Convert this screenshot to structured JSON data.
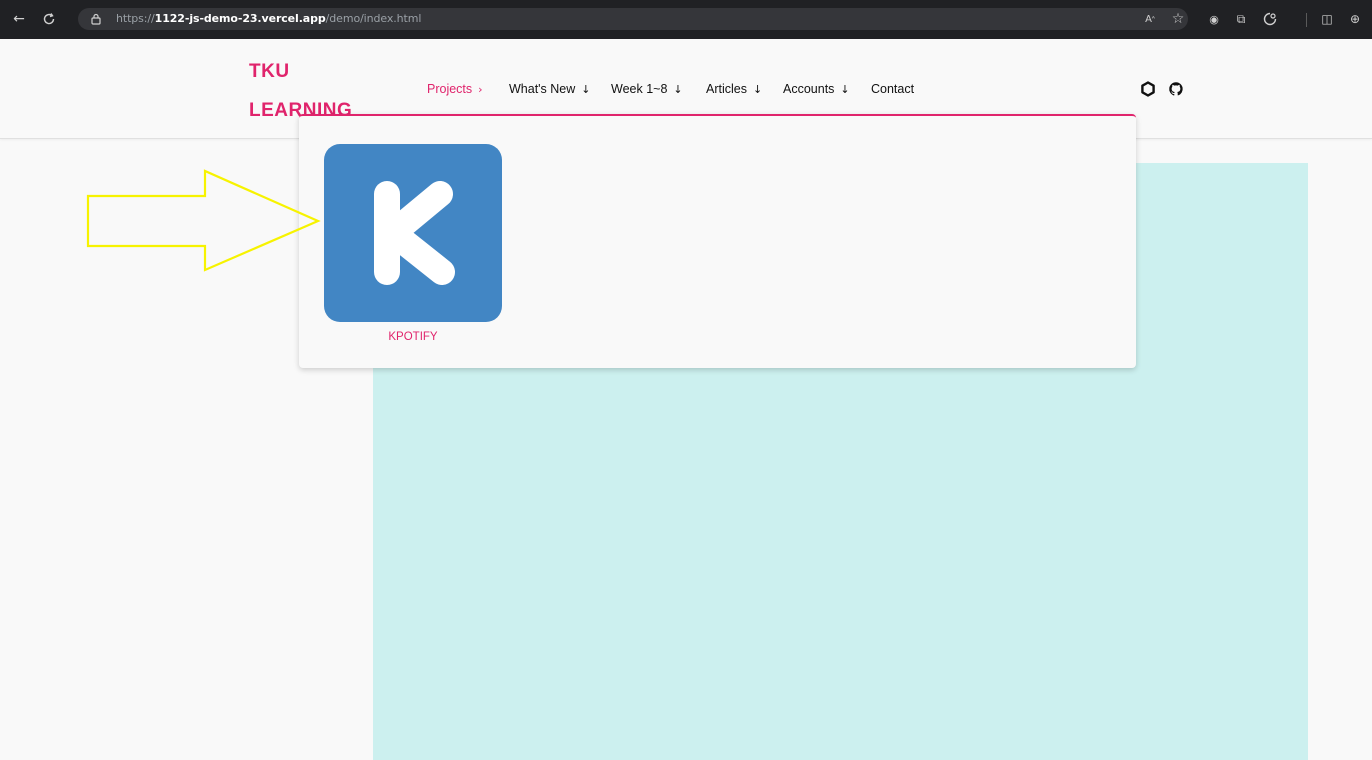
{
  "browser": {
    "url_scheme": "https://",
    "url_host": "1122-js-demo-23.vercel.app",
    "url_path": "/demo/index.html",
    "icons": [
      "back-arrow-icon",
      "refresh-icon",
      "lock-icon",
      "read-aloud-icon",
      "favorite-star-icon",
      "extension-icon",
      "collections-icon",
      "copilot-icon",
      "split-screen-icon",
      "profile-icon"
    ]
  },
  "site": {
    "logo_line1": "TKU",
    "logo_line2": "LEARNING",
    "brand_color": "#e0246c",
    "nav": [
      {
        "label": "Projects",
        "arrow": "›",
        "active": true
      },
      {
        "label": "What's New",
        "arrow": "↓",
        "active": false
      },
      {
        "label": "Week 1~8",
        "arrow": "↓",
        "active": false
      },
      {
        "label": "Articles",
        "arrow": "↓",
        "active": false
      },
      {
        "label": "Accounts",
        "arrow": "↓",
        "active": false
      },
      {
        "label": "Contact",
        "arrow": "",
        "active": false
      }
    ],
    "header_icons": [
      "hexagon-icon",
      "github-icon"
    ]
  },
  "dropdown": {
    "projects": [
      {
        "letter": "K",
        "label": "KPOTIFY",
        "tile_color": "#4286c4"
      }
    ]
  },
  "annotation": {
    "type": "arrow",
    "color": "#f7f300"
  },
  "content_panel": {
    "color": "#ccf0ef"
  }
}
